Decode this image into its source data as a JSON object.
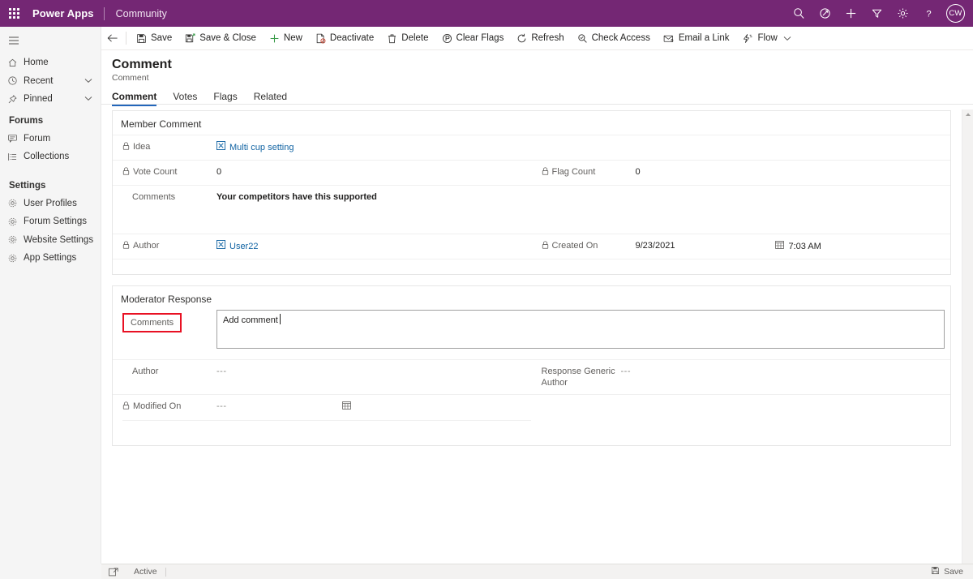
{
  "header": {
    "waffle_label": "app-launcher",
    "brand": "Power Apps",
    "environment": "Community",
    "icons": [
      {
        "name": "search-icon",
        "label": "Search"
      },
      {
        "name": "relevance-assistant-icon",
        "label": "Assistant"
      },
      {
        "name": "plus-icon",
        "label": "New"
      },
      {
        "name": "filter-icon",
        "label": "Filter"
      },
      {
        "name": "gear-icon",
        "label": "Settings"
      },
      {
        "name": "help-icon",
        "label": "Help"
      }
    ],
    "avatar_initials": "CW",
    "brand_color": "#742774"
  },
  "sidebar": {
    "hamburger_label": "Site map",
    "items": [
      {
        "label": "Home",
        "icon": "home-icon",
        "chevron": false
      },
      {
        "label": "Recent",
        "icon": "clock-icon",
        "chevron": true
      },
      {
        "label": "Pinned",
        "icon": "pin-icon",
        "chevron": true
      }
    ],
    "groups": [
      {
        "title": "Forums",
        "items": [
          {
            "label": "Forum",
            "icon": "forum-icon"
          },
          {
            "label": "Collections",
            "icon": "collections-icon"
          }
        ]
      },
      {
        "title": "Settings",
        "items": [
          {
            "label": "User Profiles",
            "icon": "gear-icon"
          },
          {
            "label": "Forum Settings",
            "icon": "gear-icon"
          },
          {
            "label": "Website Settings",
            "icon": "gear-icon"
          },
          {
            "label": "App Settings",
            "icon": "gear-icon"
          }
        ]
      }
    ]
  },
  "commandbar": {
    "back_label": "Back",
    "buttons": [
      {
        "label": "Save",
        "icon": "save-icon"
      },
      {
        "label": "Save & Close",
        "icon": "save-close-icon"
      },
      {
        "label": "New",
        "icon": "plus-icon"
      },
      {
        "label": "Deactivate",
        "icon": "deactivate-icon"
      },
      {
        "label": "Delete",
        "icon": "trash-icon"
      },
      {
        "label": "Clear Flags",
        "icon": "clear-flags-icon"
      },
      {
        "label": "Refresh",
        "icon": "refresh-icon"
      },
      {
        "label": "Check Access",
        "icon": "check-access-icon"
      },
      {
        "label": "Email a Link",
        "icon": "email-link-icon"
      },
      {
        "label": "Flow",
        "icon": "flow-icon",
        "caret": true
      }
    ]
  },
  "form": {
    "title": "Comment",
    "subtitle": "Comment",
    "tabs": [
      {
        "label": "Comment",
        "active": true
      },
      {
        "label": "Votes",
        "active": false
      },
      {
        "label": "Flags",
        "active": false
      },
      {
        "label": "Related",
        "active": false
      }
    ],
    "member_comment": {
      "section_title": "Member Comment",
      "idea": {
        "label": "Idea",
        "value": "Multi cup setting",
        "locked": true,
        "link": true
      },
      "vote_count": {
        "label": "Vote Count",
        "value": "0",
        "locked": true
      },
      "flag_count": {
        "label": "Flag Count",
        "value": "0",
        "locked": true
      },
      "comments": {
        "label": "Comments",
        "value": "Your competitors have this supported",
        "locked": false
      },
      "author": {
        "label": "Author",
        "value": "User22",
        "locked": true,
        "link": true
      },
      "created_on": {
        "label": "Created On",
        "date": "9/23/2021",
        "time": "7:03 AM",
        "locked": true
      }
    },
    "moderator_response": {
      "section_title": "Moderator Response",
      "comments": {
        "label": "Comments",
        "value": "Add comment",
        "highlighted": true
      },
      "author": {
        "label": "Author",
        "value": "---",
        "locked": false
      },
      "response_generic_author": {
        "label": "Response Generic Author",
        "value": "---",
        "locked": false
      },
      "modified_on": {
        "label": "Modified On",
        "value": "---",
        "locked": true
      }
    }
  },
  "statusbar": {
    "expand_label": "Open in new window",
    "status": "Active",
    "save_label": "Save"
  },
  "colors": {
    "highlight": "#e81123",
    "link": "#1264a3",
    "tab_accent": "#2266bb"
  }
}
